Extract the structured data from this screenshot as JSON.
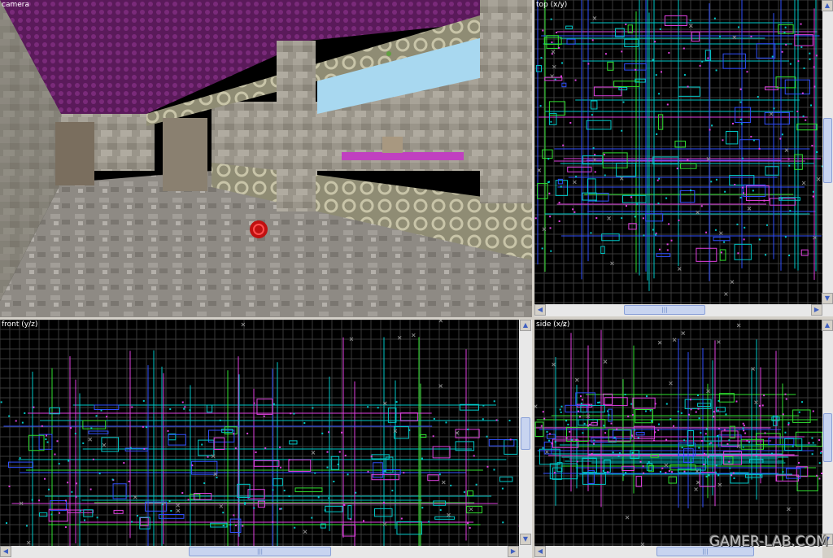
{
  "viewports": {
    "camera": {
      "label": "camera"
    },
    "top": {
      "label": "top (x/y)"
    },
    "front": {
      "label": "front (y/z)"
    },
    "side": {
      "label": "side (x/z)"
    }
  },
  "scrollbar": {
    "left_arrow": "◀",
    "right_arrow": "▶",
    "up_arrow": "▲",
    "down_arrow": "▼",
    "grip": "|||"
  },
  "watermark": "GAMER-LAB.COM",
  "colors": {
    "grid": "#3a3a3a",
    "cyan": "#00c8c8",
    "magenta": "#e040e0",
    "green": "#30e030",
    "blue": "#3050ff",
    "white": "#ffffff"
  }
}
